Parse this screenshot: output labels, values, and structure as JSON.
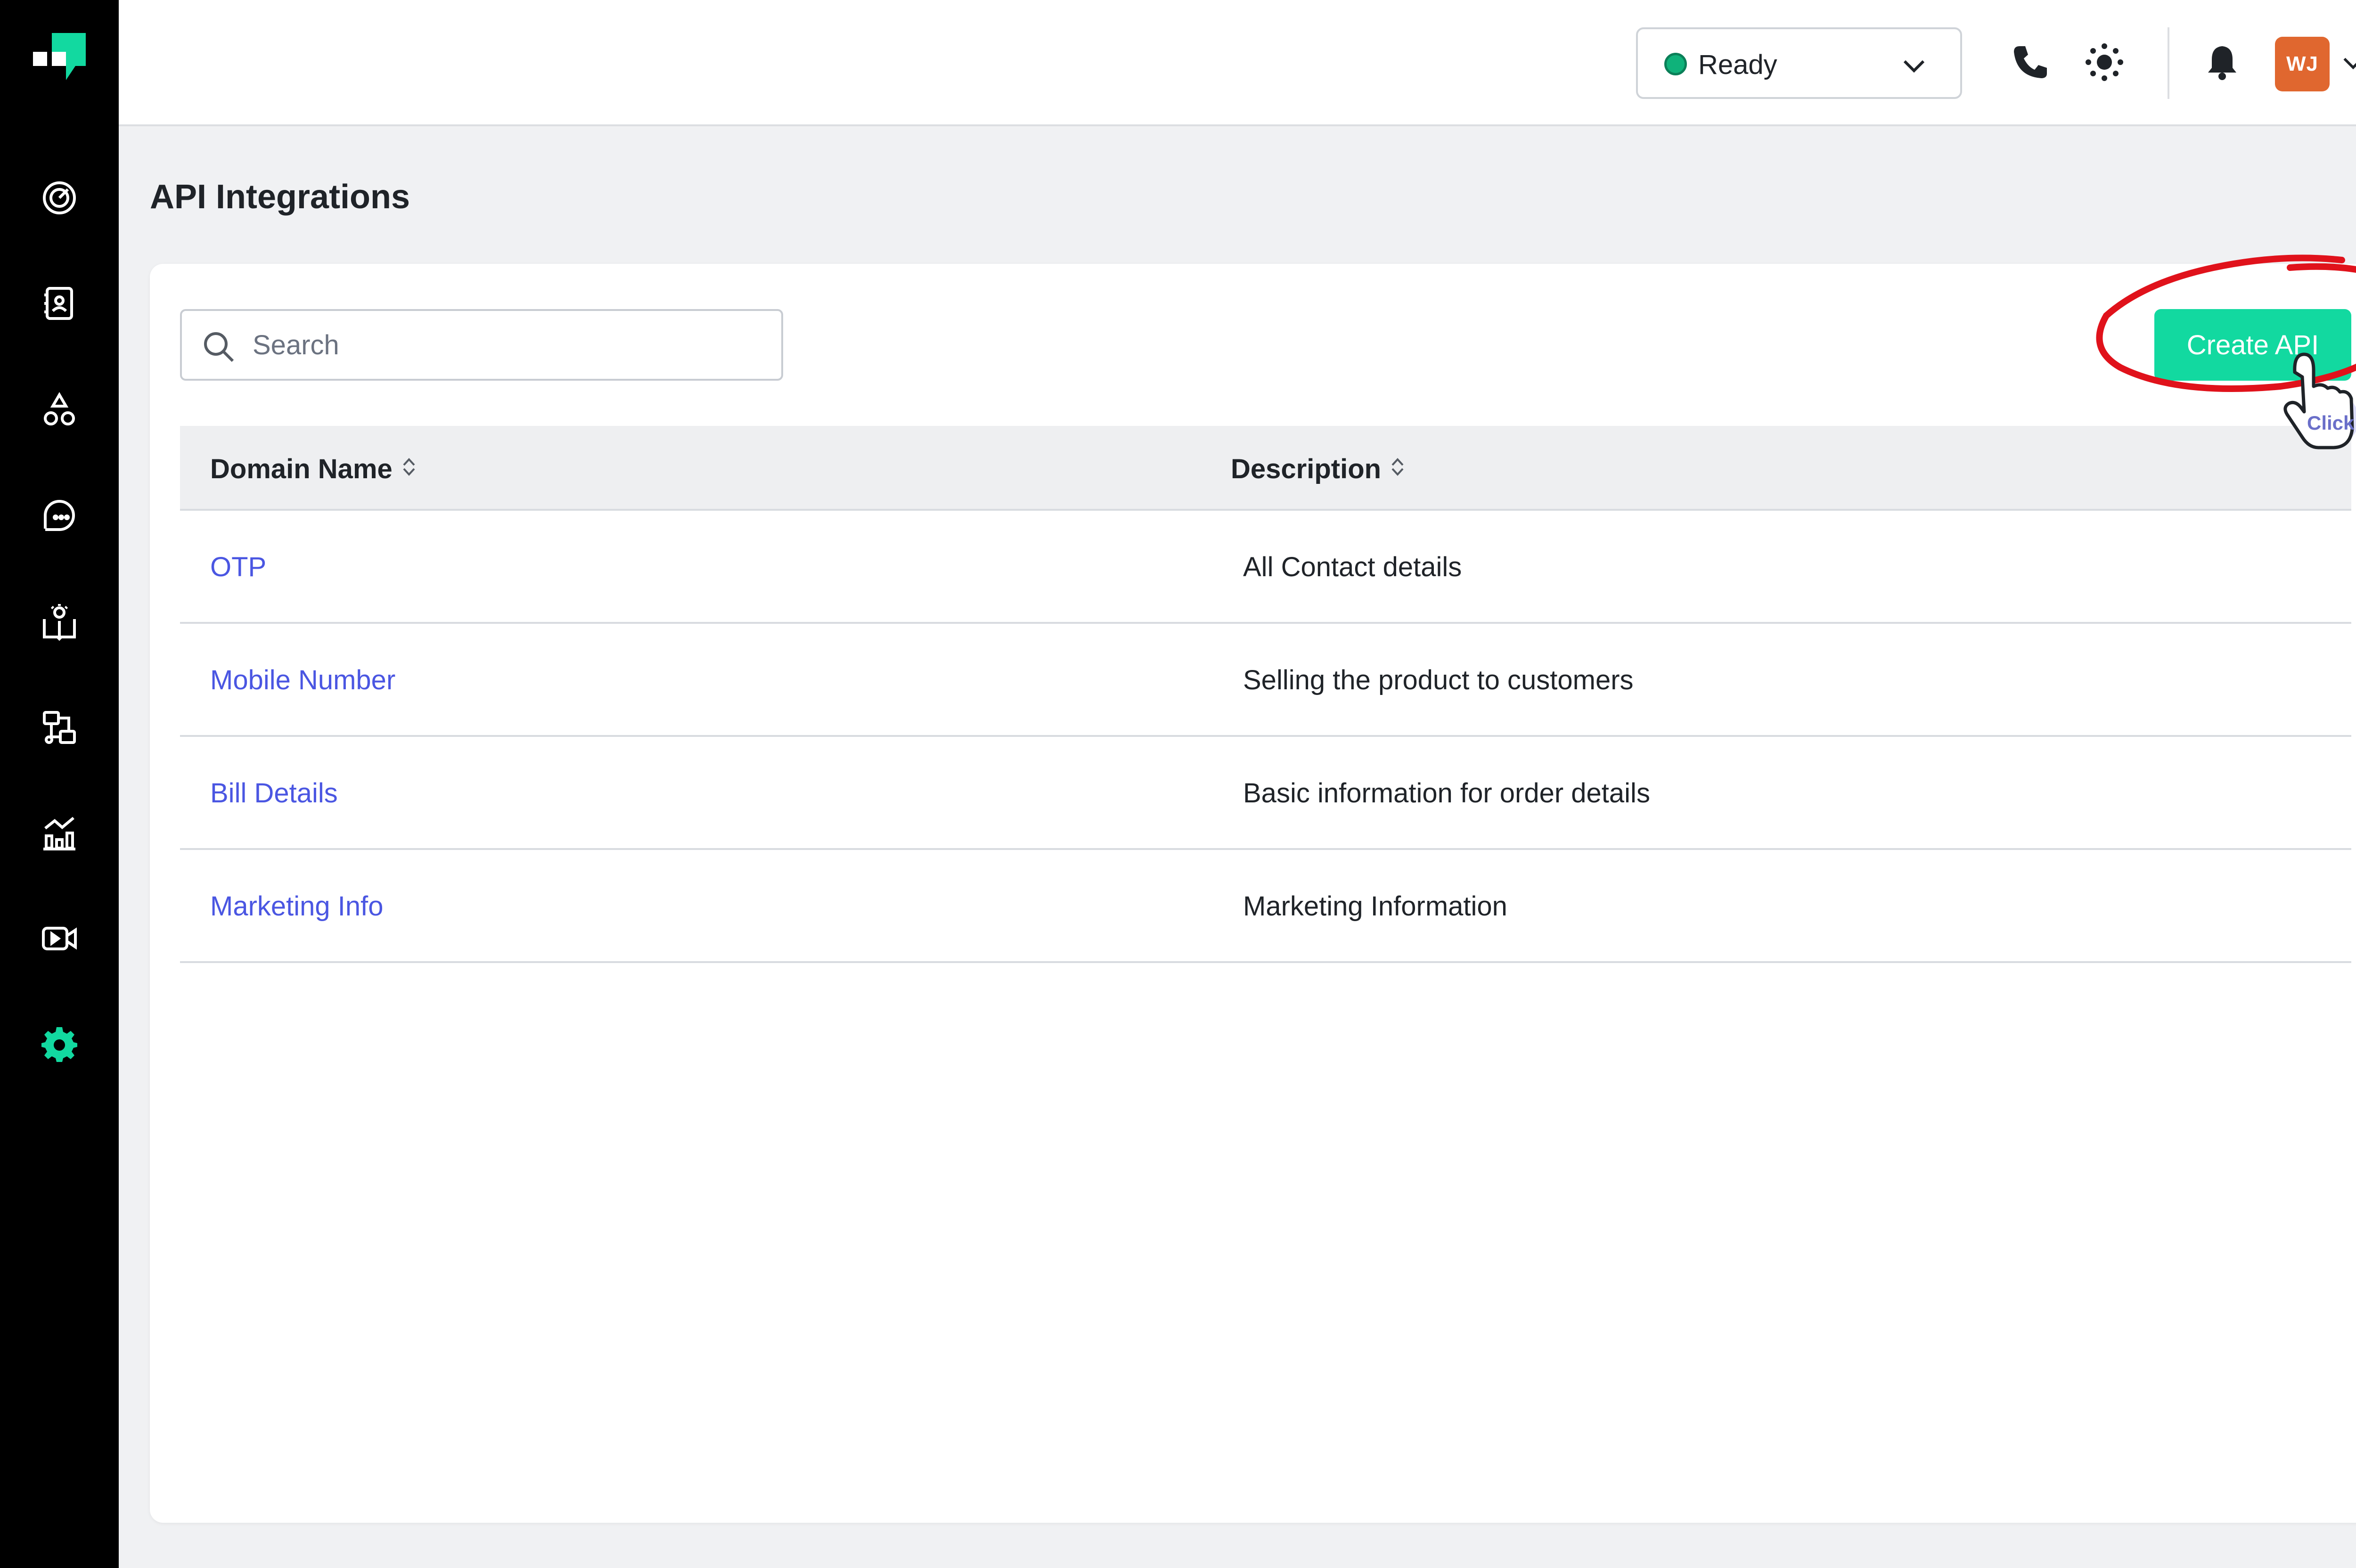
{
  "brand": {
    "logo_icon": "brand-logo-icon",
    "accent": "#12d9a0"
  },
  "sidebar": {
    "items": [
      {
        "icon": "dashboard-gauge-icon"
      },
      {
        "icon": "contacts-book-icon"
      },
      {
        "icon": "shapes-icon"
      },
      {
        "icon": "chat-bubble-icon"
      },
      {
        "icon": "knowledge-book-icon"
      },
      {
        "icon": "workflow-icon"
      },
      {
        "icon": "analytics-chart-icon"
      },
      {
        "icon": "video-icon"
      },
      {
        "icon": "settings-gear-icon",
        "active": true
      }
    ]
  },
  "header": {
    "status": {
      "label": "Ready",
      "color": "#0fb27a"
    },
    "icons": [
      "phone-icon",
      "sun-icon",
      "bell-icon"
    ],
    "user": {
      "initials": "WJ",
      "avatar_color": "#e0672f"
    }
  },
  "page": {
    "title": "API Integrations"
  },
  "search": {
    "placeholder": "Search",
    "value": ""
  },
  "toolbar": {
    "create_label": "Create API"
  },
  "table": {
    "columns": [
      "Domain Name",
      "Description"
    ],
    "rows": [
      {
        "domain": "OTP",
        "description": "All Contact details"
      },
      {
        "domain": "Mobile Number",
        "description": "Selling the product to customers"
      },
      {
        "domain": "Bill Details",
        "description": "Basic information for order details"
      },
      {
        "domain": "Marketing Info",
        "description": "Marketing Information"
      }
    ]
  },
  "annotation": {
    "label": "Click",
    "color": "#e0121b"
  }
}
